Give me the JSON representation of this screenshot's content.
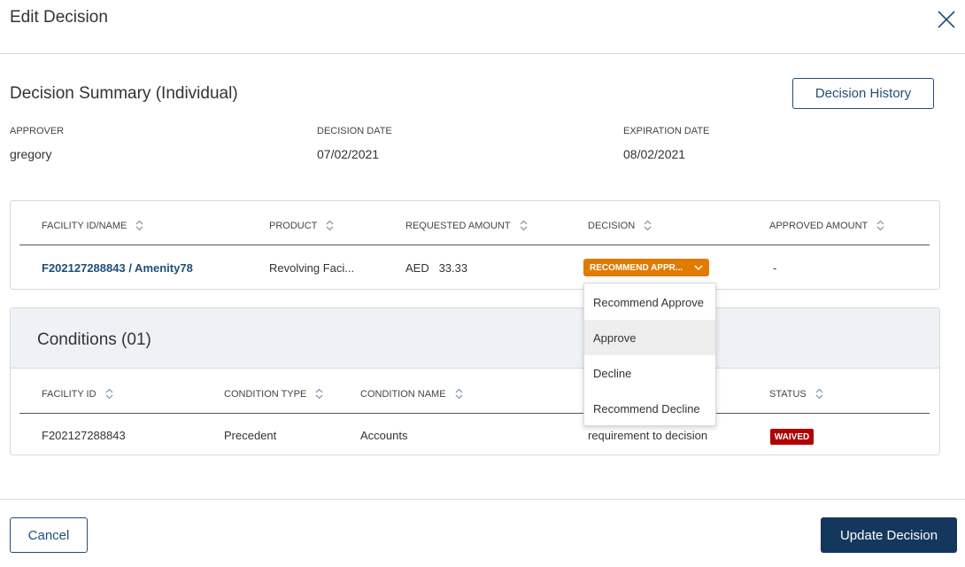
{
  "modal": {
    "title": "Edit Decision"
  },
  "summary": {
    "title": "Decision Summary (Individual)",
    "history_label": "Decision History",
    "approver_label": "APPROVER",
    "approver_value": "gregory",
    "decision_date_label": "DECISION DATE",
    "decision_date_value": "07/02/2021",
    "expiration_date_label": "EXPIRATION DATE",
    "expiration_date_value": "08/02/2021"
  },
  "facilities": {
    "columns": [
      "FACILITY ID/NAME",
      "PRODUCT",
      "REQUESTED AMOUNT",
      "DECISION",
      "APPROVED AMOUNT"
    ],
    "rows": [
      {
        "facility": "F202127288843 / Amenity78",
        "product": "Revolving Faci...",
        "currency": "AED",
        "amount": "33.33",
        "decision": "RECOMMEND APPR...",
        "approved": "-"
      }
    ]
  },
  "decision_dropdown": {
    "options": [
      "Recommend Approve",
      "Approve",
      "Decline",
      "Recommend Decline"
    ],
    "hovered": "Approve"
  },
  "conditions": {
    "title": "Conditions (01)",
    "columns": [
      "FACILITY ID",
      "CONDITION TYPE",
      "CONDITION NAME",
      "STATUS"
    ],
    "rows": [
      {
        "facility_id": "F202127288843",
        "type": "Precedent",
        "name": "Accounts",
        "description": "requirement to decision",
        "status": "WAIVED"
      }
    ]
  },
  "footer": {
    "cancel_label": "Cancel",
    "update_label": "Update Decision"
  },
  "colors": {
    "primary": "#14375e",
    "link": "#1f4e79",
    "decision": "#e07b00",
    "waived": "#b30000"
  },
  "icons": {
    "close": "close-icon",
    "sort": "sort-icon",
    "chevron": "chevron-down-icon"
  }
}
